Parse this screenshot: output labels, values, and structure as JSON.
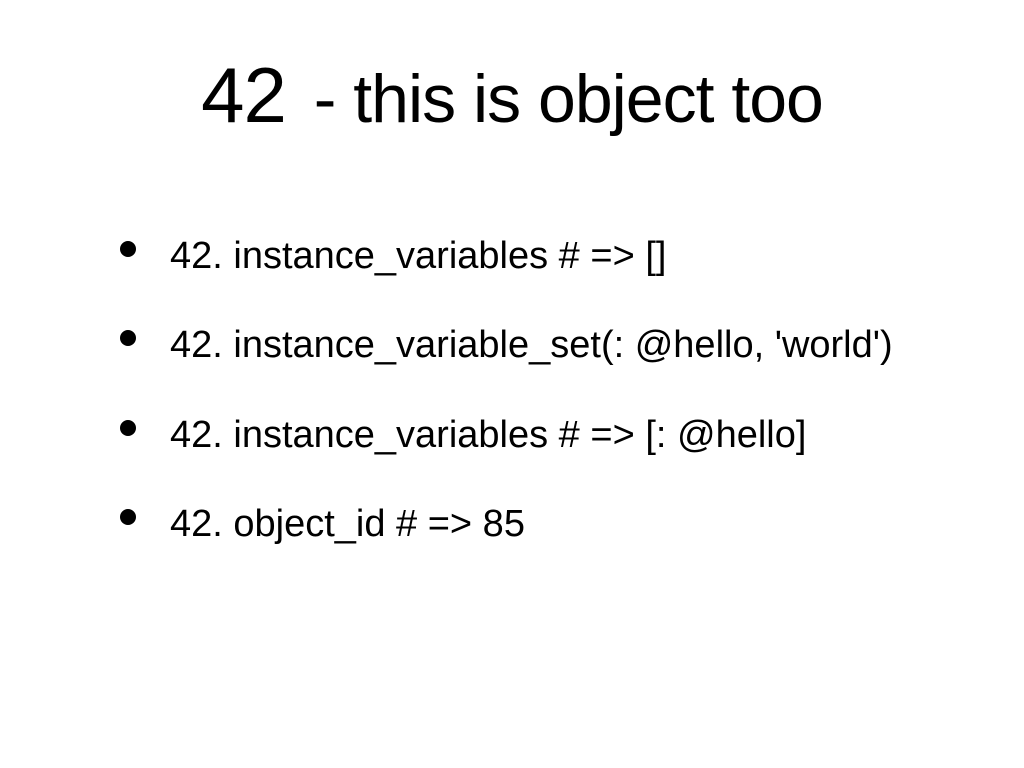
{
  "slide": {
    "title_number": "42",
    "title_rest": " - this is object too",
    "bullets": [
      "42. instance_variables #  => []",
      "42. instance_variable_set(: @hello, 'world')",
      "42. instance_variables # => [: @hello]",
      "42. object_id # => 85"
    ]
  }
}
